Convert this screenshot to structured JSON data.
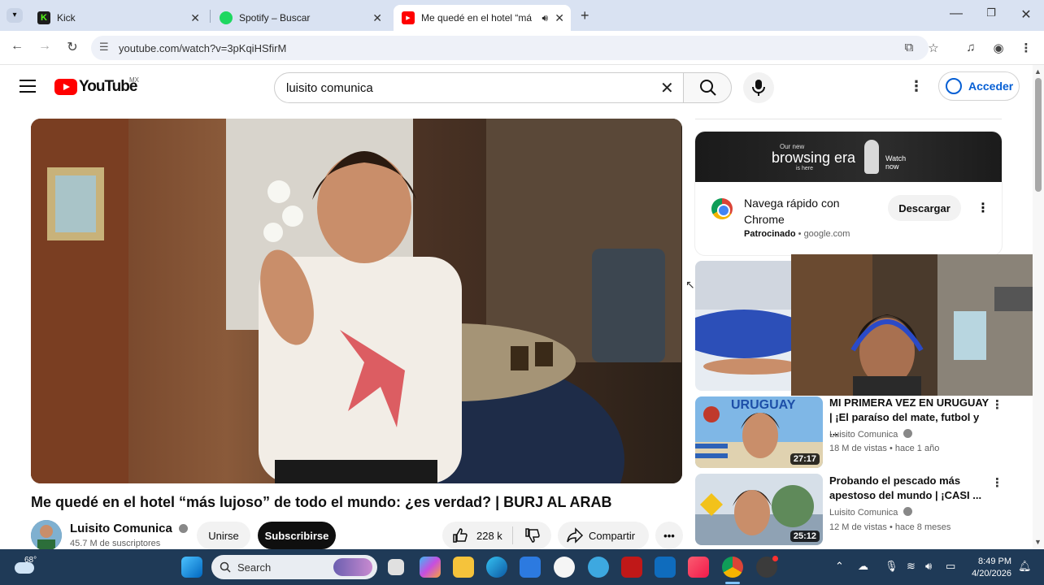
{
  "browser": {
    "tabs": [
      {
        "label": "Kick",
        "icon": "kick-icon"
      },
      {
        "label": "Spotify – Buscar",
        "icon": "spotify-icon"
      },
      {
        "label": "Me quedé en el hotel “más",
        "icon": "youtube-icon"
      }
    ],
    "url": "youtube.com/watch?v=3pKqiHSfirM"
  },
  "youtube": {
    "country_code": "MX",
    "logo_text": "YouTube",
    "search_value": "luisito comunica",
    "signin_label": "Acceder"
  },
  "video": {
    "title": "Me quedé en el hotel “más lujoso” de todo el mundo: ¿es verdad? | BURJ AL ARAB",
    "channel": "Luisito Comunica",
    "subscribers": "45.7 M de suscriptores",
    "join_label": "Unirse",
    "subscribe_label": "Subscribirse",
    "likes": "228 k",
    "share_label": "Compartir"
  },
  "ad": {
    "banner_line1": "Our new",
    "banner_line2": "browsing era",
    "banner_line3": "is here",
    "banner_cta": "Watch now",
    "title": "Navega rápido con Chrome",
    "sponsor_label": "Patrocinado",
    "sponsor_domain": "google.com",
    "download_label": "Descargar"
  },
  "recommendations": [
    {
      "title": "MI PRIMERA VEZ EN URUGUAY | ¡El paraíso del mate, futbol y ...",
      "channel": "Luisito Comunica",
      "meta": "18 M de vistas • hace 1 año",
      "duration": "27:17",
      "thumb_text": "URUGUAY"
    },
    {
      "title": "Probando el pescado más apestoso del mundo | ¡CASI ...",
      "channel": "Luisito Comunica",
      "meta": "12 M de vistas • hace 8 meses",
      "duration": "25:12"
    }
  ],
  "taskbar": {
    "temperature": "68°",
    "search_placeholder": "Search",
    "time": "8:49 PM",
    "date": "4/20/2026"
  }
}
